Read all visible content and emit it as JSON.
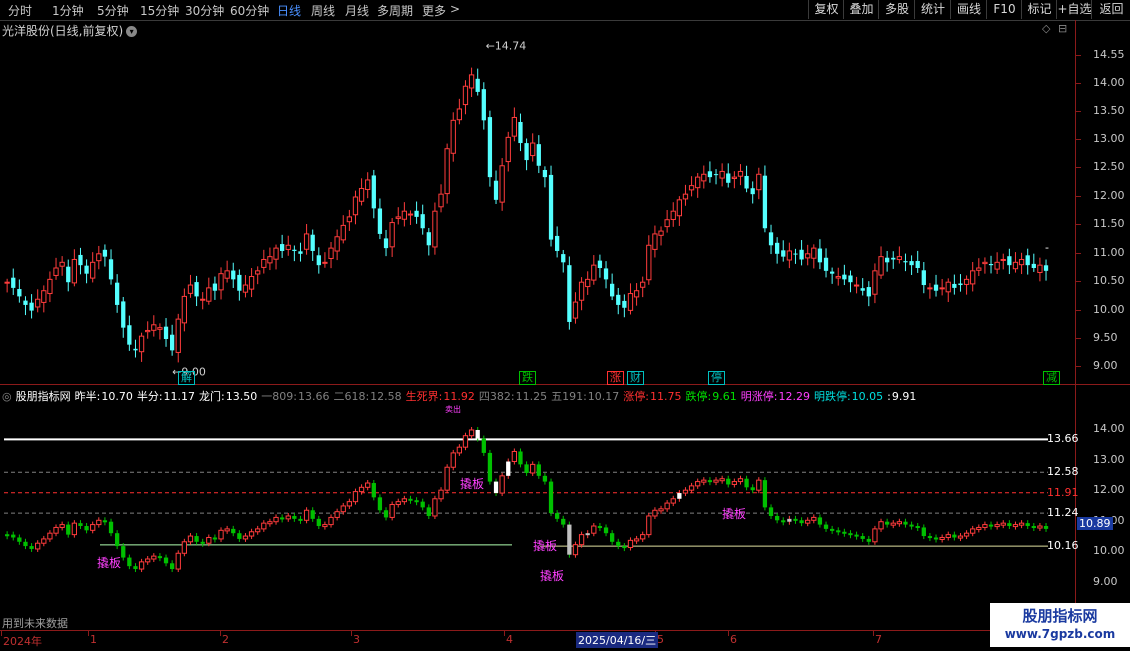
{
  "toolbar": {
    "periods": [
      "分时",
      "1分钟",
      "5分钟",
      "15分钟",
      "30分钟",
      "60分钟",
      "日线",
      "周线",
      "月线",
      "多周期",
      "更多"
    ],
    "active_period": "日线",
    "more_arrow": ">",
    "buttons": [
      "复权",
      "叠加",
      "多股",
      "统计",
      "画线",
      "F10",
      "标记",
      "+自选",
      "返回"
    ]
  },
  "stock": {
    "title": "光洋股份(日线,前复权)",
    "dropdown_icon": "chevron-down-icon"
  },
  "main_chart": {
    "y_labels": [
      "14.55",
      "14.00",
      "13.50",
      "13.00",
      "12.50",
      "12.00",
      "11.50",
      "11.00",
      "10.50",
      "10.00",
      "9.50",
      "9.00"
    ],
    "high_label": "14.74",
    "low_label": "9.00",
    "last_price_marker": "-",
    "events": [
      {
        "text": "解",
        "color": "#00c0c0"
      },
      {
        "text": "跌",
        "color": "#00c000"
      },
      {
        "text": "涨",
        "color": "#ff3030"
      },
      {
        "text": "财",
        "color": "#00c0c0"
      },
      {
        "text": "停",
        "color": "#00c0c0"
      },
      {
        "text": "减",
        "color": "#00c000"
      }
    ],
    "up_color": "#ff3c3c",
    "down_color": "#54ffff"
  },
  "indicator": {
    "name": "股朋指标网",
    "fields": [
      {
        "label": "昨半:",
        "value": "10.70",
        "color": "#ffffff"
      },
      {
        "label": "半分:",
        "value": "11.17",
        "color": "#ffffff"
      },
      {
        "label": "龙门:",
        "value": "13.50",
        "color": "#ffffff"
      },
      {
        "label": "一809:",
        "value": "13.66",
        "color": "#808080"
      },
      {
        "label": "二618:",
        "value": "12.58",
        "color": "#808080"
      },
      {
        "label": "生死界:",
        "value": "11.92",
        "color": "#ff3030"
      },
      {
        "label": "四382:",
        "value": "11.25",
        "color": "#808080"
      },
      {
        "label": "五191:",
        "value": "10.17",
        "color": "#808080"
      },
      {
        "label": "涨停:",
        "value": "11.75",
        "color": "#ff3030"
      },
      {
        "label": "跌停:",
        "value": "9.61",
        "color": "#00e000"
      },
      {
        "label": "明涨停:",
        "value": "12.29",
        "color": "#ff40ff"
      },
      {
        "label": "明跌停:",
        "value": "10.05",
        "color": "#00e0e0"
      },
      {
        "label": ":",
        "value": "9.91",
        "color": "#ffffff"
      }
    ],
    "y_labels": [
      "14.00",
      "13.00",
      "12.00",
      "11.00",
      "10.00",
      "9.00"
    ],
    "right_values": [
      {
        "text": "13.66",
        "color": "#ffffff"
      },
      {
        "text": "12.58",
        "color": "#ffffff"
      },
      {
        "text": "11.91",
        "color": "#ff3030"
      },
      {
        "text": "11.24",
        "color": "#ffffff"
      },
      {
        "text": "10.16",
        "color": "#ffffff"
      }
    ],
    "current_value": "10.89",
    "annotations": [
      {
        "text": "撬板"
      },
      {
        "text": "撬板"
      },
      {
        "text": "撬板"
      },
      {
        "text": "撬板"
      },
      {
        "text": "撬板"
      }
    ],
    "top_marker": "卖出",
    "future_data_note": "用到未来数据"
  },
  "bottom_axis": {
    "labels": [
      "2024年",
      "1",
      "2",
      "3",
      "4",
      "5",
      "6",
      "7"
    ],
    "selected_date": "2025/04/16/三"
  },
  "watermark": {
    "line1": "股朋指标网",
    "line2": "www.7gpzb.com"
  }
}
